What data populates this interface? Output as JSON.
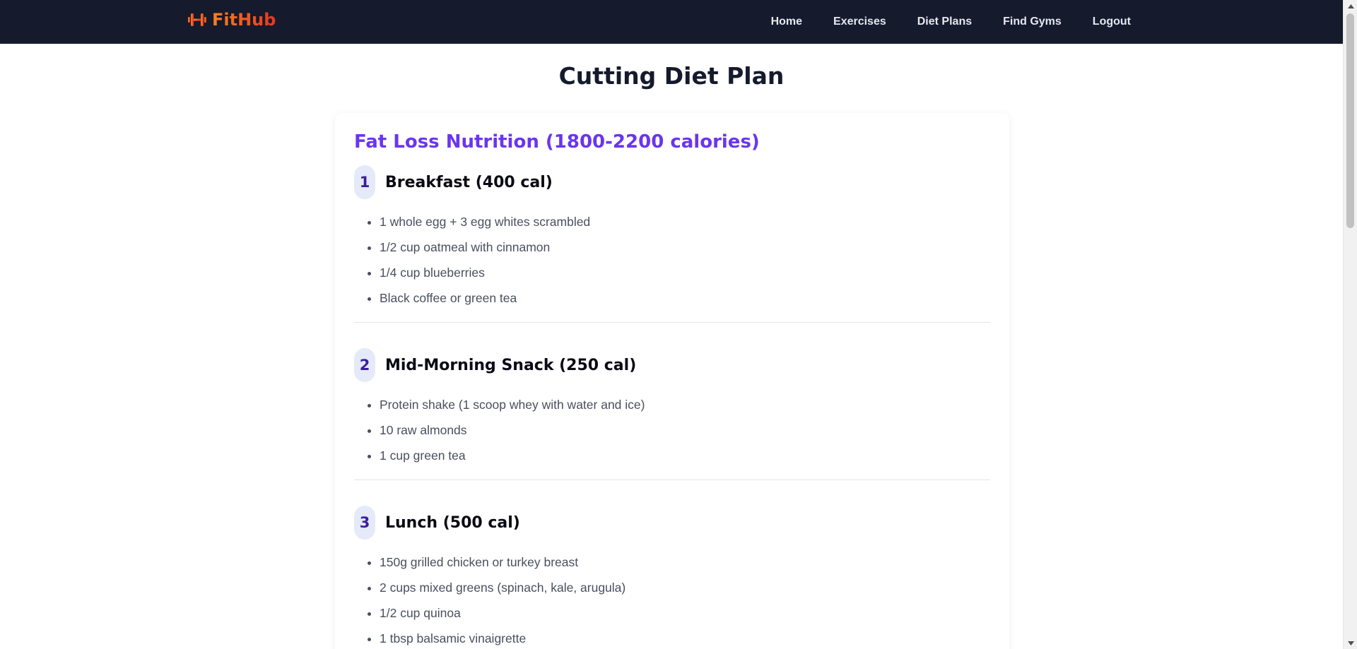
{
  "navbar": {
    "brand": "FitHub",
    "brand_icon": "dumbbell-icon",
    "links": [
      {
        "label": "Home"
      },
      {
        "label": "Exercises"
      },
      {
        "label": "Diet Plans"
      },
      {
        "label": "Find Gyms"
      },
      {
        "label": "Logout"
      }
    ]
  },
  "page": {
    "title": "Cutting Diet Plan"
  },
  "plan": {
    "heading": "Fat Loss Nutrition (1800-2200 calories)",
    "meals": [
      {
        "number": "1",
        "title": "Breakfast (400 cal)",
        "items": [
          "1 whole egg + 3 egg whites scrambled",
          "1/2 cup oatmeal with cinnamon",
          "1/4 cup blueberries",
          "Black coffee or green tea"
        ]
      },
      {
        "number": "2",
        "title": "Mid-Morning Snack (250 cal)",
        "items": [
          "Protein shake (1 scoop whey with water and ice)",
          "10 raw almonds",
          "1 cup green tea"
        ]
      },
      {
        "number": "3",
        "title": "Lunch (500 cal)",
        "items": [
          "150g grilled chicken or turkey breast",
          "2 cups mixed greens (spinach, kale, arugula)",
          "1/2 cup quinoa",
          "1 tbsp balsamic vinaigrette"
        ]
      }
    ]
  },
  "colors": {
    "navbar_bg": "#151a2d",
    "brand_orange": "#f26a1b",
    "heading_purple": "#6a35f0",
    "badge_bg": "#e4eaf8"
  }
}
